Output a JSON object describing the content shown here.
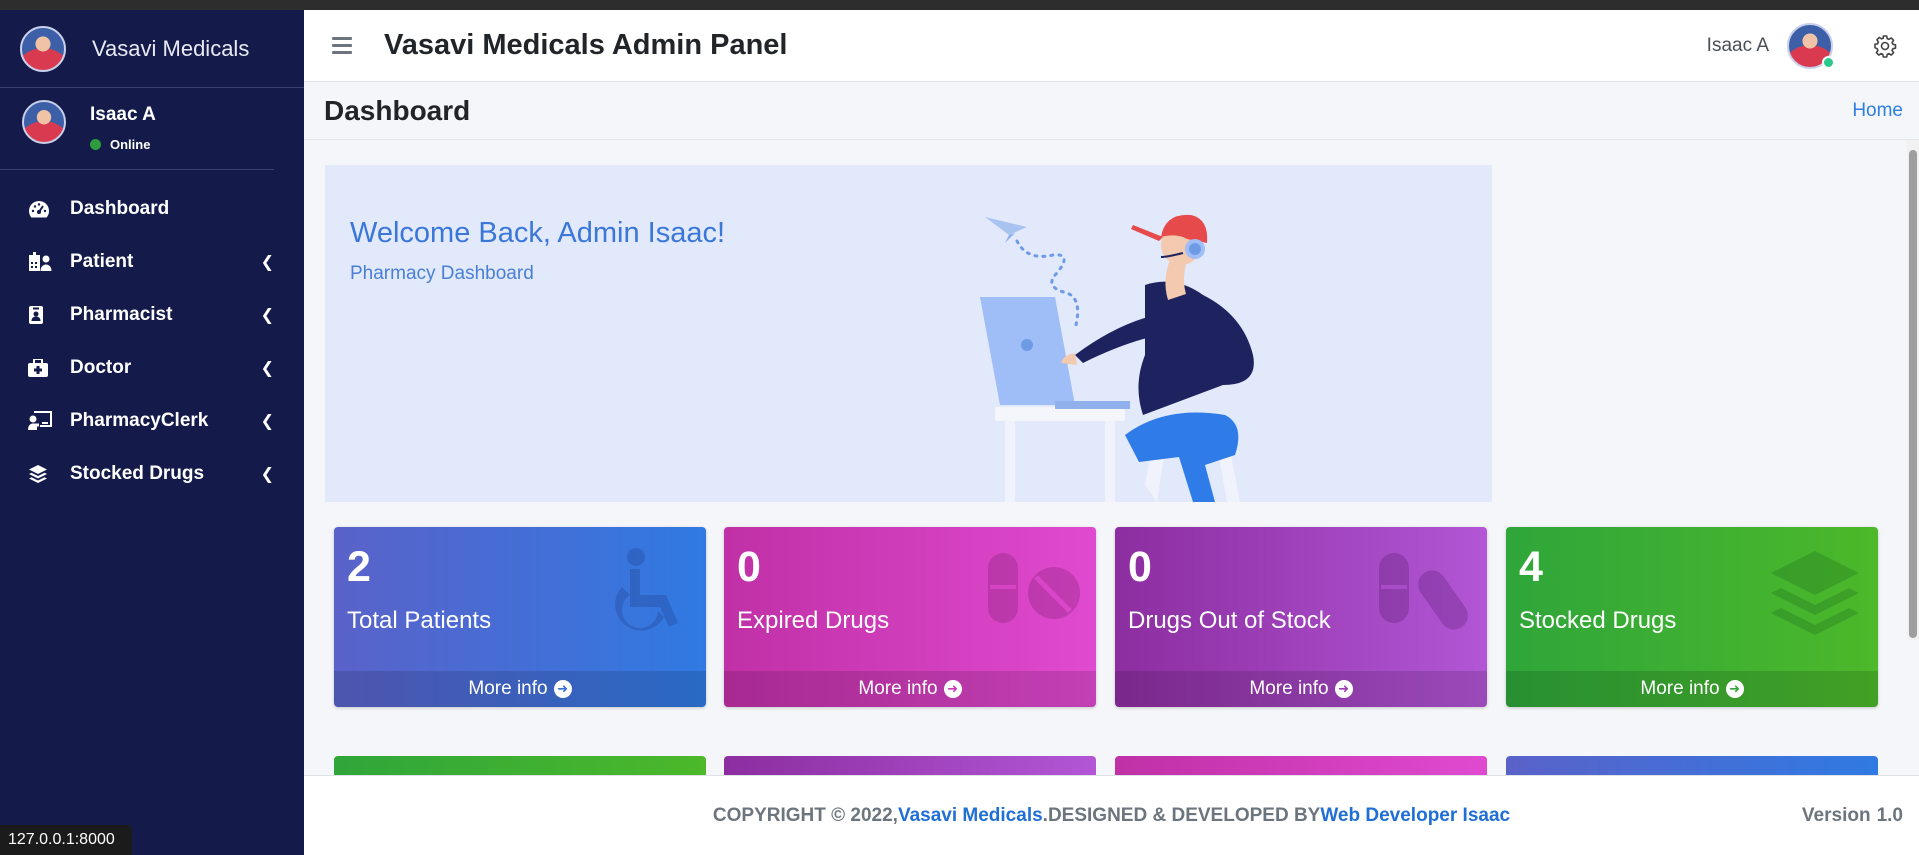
{
  "sidebar": {
    "brand": "Vasavi Medicals",
    "user_name": "Isaac A",
    "user_status": "Online",
    "items": [
      {
        "label": "Dashboard",
        "icon": "tachometer-icon",
        "has_children": false
      },
      {
        "label": "Patient",
        "icon": "hospital-user-icon",
        "has_children": true
      },
      {
        "label": "Pharmacist",
        "icon": "id-badge-icon",
        "has_children": true
      },
      {
        "label": "Doctor",
        "icon": "first-aid-kit-icon",
        "has_children": true
      },
      {
        "label": "PharmacyClerk",
        "icon": "chalkboard-teacher-icon",
        "has_children": true
      },
      {
        "label": "Stocked Drugs",
        "icon": "layer-stack-icon",
        "has_children": true
      }
    ]
  },
  "status_bar": "127.0.0.1:8000",
  "navbar": {
    "title": "Vasavi Medicals Admin Panel",
    "user_name": "Isaac A"
  },
  "header": {
    "title": "Dashboard",
    "breadcrumb": "Home"
  },
  "welcome": {
    "heading": "Welcome Back, Admin Isaac!",
    "subheading": "Pharmacy Dashboard"
  },
  "stats": [
    {
      "value": "2",
      "label": "Total Patients",
      "more": "More info",
      "icon": "wheelchair-icon",
      "color": "#2f7ae2"
    },
    {
      "value": "0",
      "label": "Expired Drugs",
      "more": "More info",
      "icon": "pills-icon",
      "color": "#e04ad0"
    },
    {
      "value": "0",
      "label": "Drugs Out of Stock",
      "more": "More info",
      "icon": "capsules-icon",
      "color": "#b256d6"
    },
    {
      "value": "4",
      "label": "Stocked Drugs",
      "more": "More info",
      "icon": "layer-stack-icon",
      "color": "#4cb82a"
    }
  ],
  "footer": {
    "prefix": "COPYRIGHT © 2022, ",
    "brand_link": "Vasavi Medicals",
    "middle": ".DESIGNED & DEVELOPED BY ",
    "dev_link": "Web Developer Isaac",
    "version_label": "Version",
    "version_value": "1.0"
  }
}
